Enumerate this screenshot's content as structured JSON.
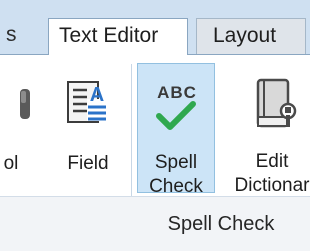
{
  "tabs": [
    {
      "label": "s",
      "state": "partial"
    },
    {
      "label": "Text Editor",
      "state": "active"
    },
    {
      "label": "Layout",
      "state": "inactive"
    }
  ],
  "ribbon": {
    "buttons": {
      "tool": {
        "label": "ol",
        "icon": "tool-icon"
      },
      "field": {
        "label": "Field",
        "icon": "field-icon"
      },
      "spell_check": {
        "label_line1": "Spell",
        "label_line2": "Check",
        "icon": "abc-checkmark-icon",
        "glyph_text": "ABC",
        "state": "pressed"
      },
      "edit_dictionary": {
        "label_line1": "Edit",
        "label_line2": "Dictionar",
        "icon": "dictionary-icon"
      }
    },
    "group_label": "Spell Check"
  },
  "colors": {
    "tab_strip": "#cfe0f1",
    "pressed_fill": "#cce4f7",
    "pressed_border": "#92c0e0",
    "check_green": "#2fa84f",
    "field_blue": "#2b73c9",
    "group_bar": "#f2f4f7"
  }
}
